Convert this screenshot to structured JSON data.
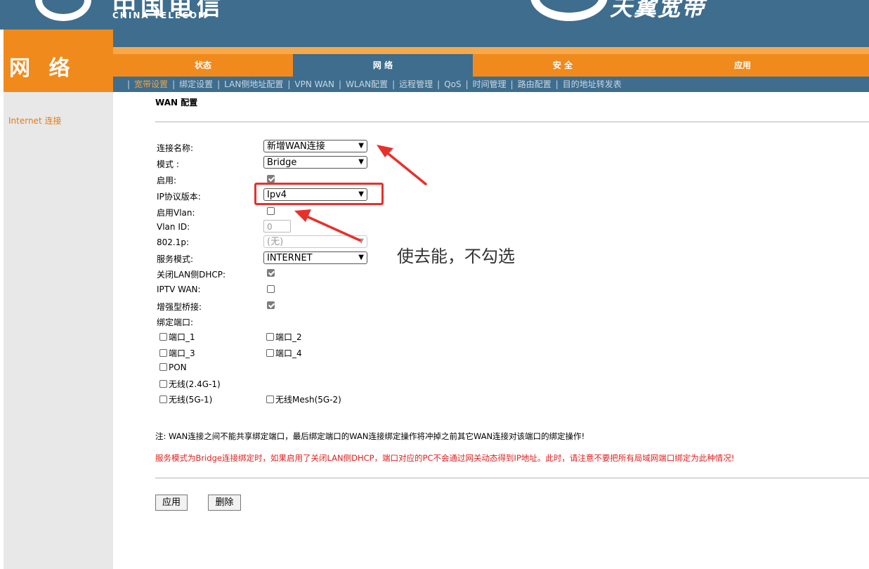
{
  "banner": {
    "brand_cn": "中国电信",
    "brand_en": "CHINA TELECOM",
    "product_cn": "天翼宽带"
  },
  "left_brand": "网 络",
  "main_nav": [
    {
      "label": "状态",
      "active": false
    },
    {
      "label": "网 络",
      "active": true
    },
    {
      "label": "安 全",
      "active": false
    },
    {
      "label": "应用",
      "active": false
    }
  ],
  "sub_nav": [
    {
      "label": "宽带设置",
      "active": true
    },
    {
      "label": "绑定设置",
      "active": false
    },
    {
      "label": "LAN侧地址配置",
      "active": false
    },
    {
      "label": "VPN WAN",
      "active": false
    },
    {
      "label": "WLAN配置",
      "active": false
    },
    {
      "label": "远程管理",
      "active": false
    },
    {
      "label": "QoS",
      "active": false
    },
    {
      "label": "时间管理",
      "active": false
    },
    {
      "label": "路由配置",
      "active": false
    },
    {
      "label": "目的地址转发表",
      "active": false
    }
  ],
  "sidebar": {
    "item": "Internet 连接"
  },
  "form": {
    "title": "WAN 配置",
    "conn_name": {
      "label": "连接名称:",
      "value": "新增WAN连接"
    },
    "mode": {
      "label": "模式 :",
      "value": "Bridge"
    },
    "enable": {
      "label": "启用:",
      "checked": true
    },
    "ip_version": {
      "label": "IP协议版本:",
      "value": "Ipv4"
    },
    "enable_vlan": {
      "label": "启用Vlan:",
      "checked": false
    },
    "vlan_id": {
      "label": "Vlan ID:",
      "value": "0"
    },
    "dot1p": {
      "label": "802.1p:",
      "value": "(无)"
    },
    "service_mode": {
      "label": "服务模式:",
      "value": "INTERNET"
    },
    "disable_lan_dhcp": {
      "label": "关闭LAN侧DHCP:",
      "checked": true
    },
    "iptv_wan": {
      "label": "IPTV WAN:",
      "checked": false
    },
    "enhanced_bridge": {
      "label": "增强型桥接:",
      "checked": true
    },
    "bind_ports": {
      "label": "绑定端口:"
    },
    "ports": [
      {
        "label": "端口_1",
        "checked": false
      },
      {
        "label": "端口_2",
        "checked": false
      },
      {
        "label": "端口_3",
        "checked": false
      },
      {
        "label": "端口_4",
        "checked": false
      },
      {
        "label": "PON",
        "checked": false
      },
      {
        "label": "无线(2.4G-1)",
        "checked": false
      },
      {
        "label": "无线(5G-1)",
        "checked": false
      },
      {
        "label": "无线Mesh(5G-2)",
        "checked": false
      }
    ]
  },
  "notes": {
    "note1": "注: WAN连接之间不能共享绑定端口，最后绑定端口的WAN连接绑定操作将冲掉之前其它WAN连接对该端口的绑定操作!",
    "note2": "服务模式为Bridge连接绑定时，如果启用了关闭LAN侧DHCP，端口对应的PC不会通过网关动态得到IP地址。此时，请注意不要把所有局域网端口绑定为此种情况!"
  },
  "buttons": {
    "apply": "应用",
    "delete": "删除"
  },
  "annotation": {
    "text": "使去能，不勾选",
    "color": "#e8302a"
  }
}
